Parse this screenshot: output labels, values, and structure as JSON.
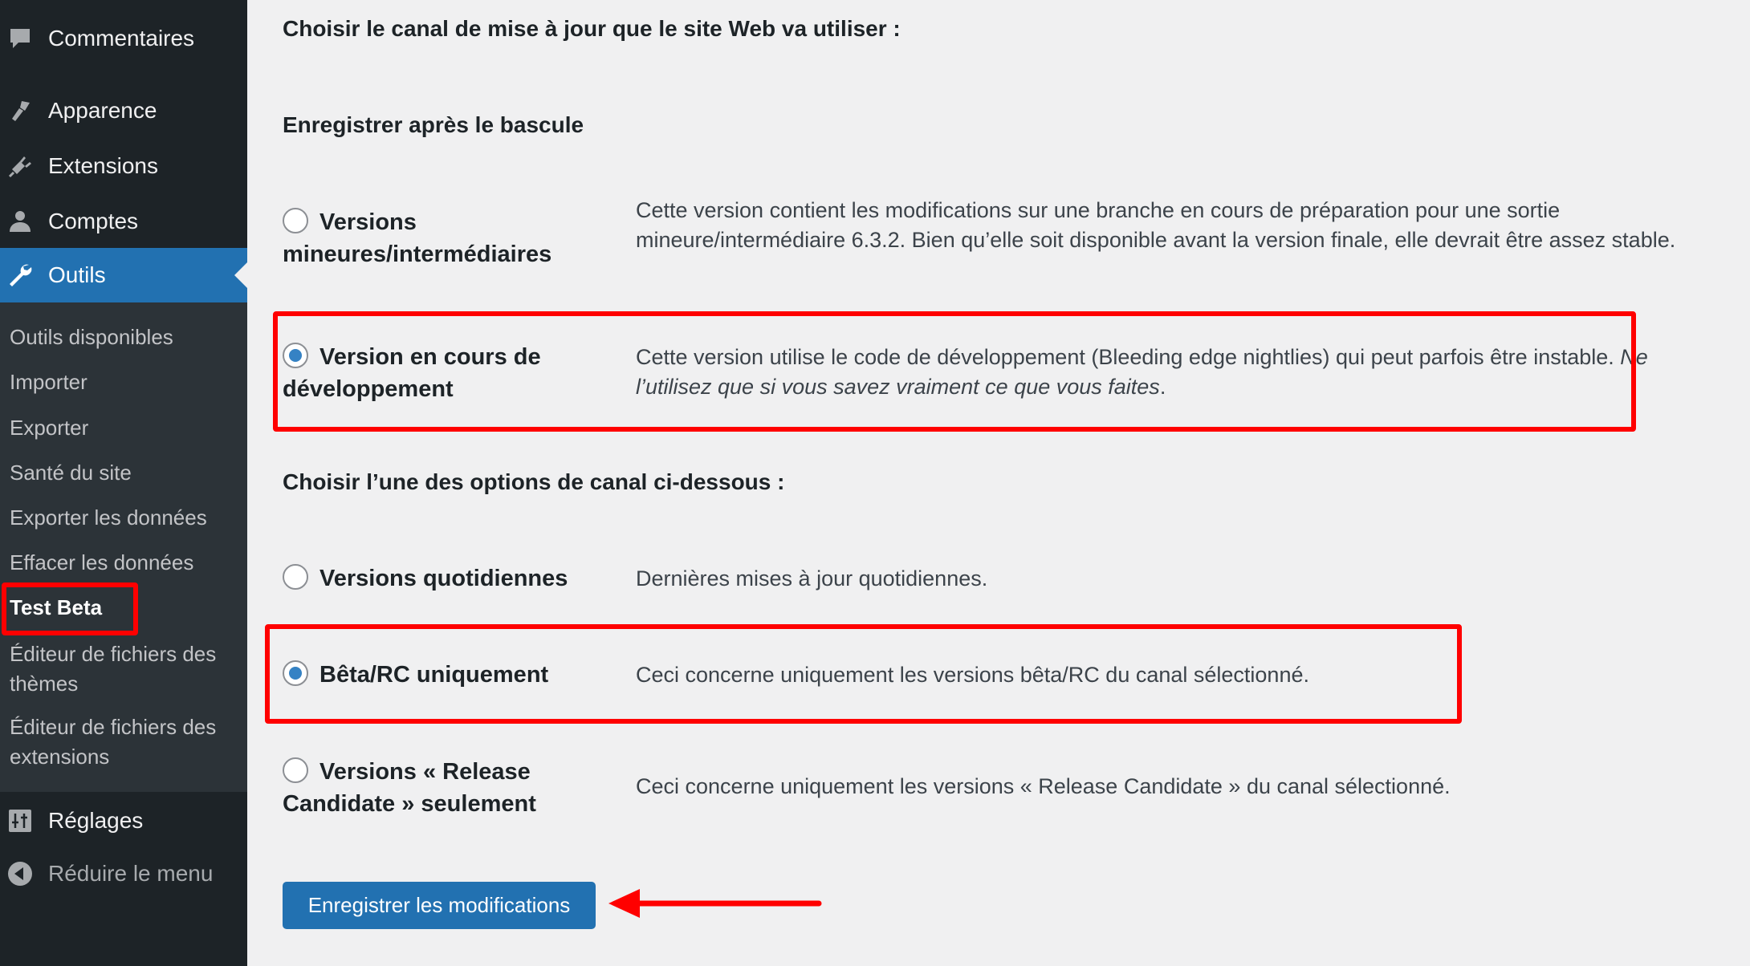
{
  "sidebar": {
    "menu": [
      {
        "label": "Commentaires",
        "icon": "comment-icon"
      },
      {
        "label": "Apparence",
        "icon": "paintbrush-icon"
      },
      {
        "label": "Extensions",
        "icon": "plugin-icon"
      },
      {
        "label": "Comptes",
        "icon": "user-icon"
      },
      {
        "label": "Outils",
        "icon": "wrench-icon",
        "active": true
      }
    ],
    "submenu": [
      "Outils disponibles",
      "Importer",
      "Exporter",
      "Santé du site",
      "Exporter les données",
      "Effacer les données",
      "Test Beta",
      "Éditeur de fichiers des thèmes",
      "Éditeur de fichiers des extensions"
    ],
    "current_submenu": "Test Beta",
    "settings_label": "Réglages",
    "collapse_label": "Réduire le menu"
  },
  "main": {
    "heading_channel": "Choisir le canal de mise à jour que le site Web va utiliser :",
    "heading_save_after": "Enregistrer après le bascule",
    "channel_options": [
      {
        "label": "Versions mineures/intermédiaires",
        "description": "Cette version contient les modifications sur une branche en cours de préparation pour une sortie mineure/intermédiaire 6.3.2. Bien qu’elle soit disponible avant la version finale, elle devrait être assez stable.",
        "checked": false
      },
      {
        "label": "Version en cours de développement",
        "description": "Cette version utilise le code de développement (Bleeding edge nightlies) qui peut parfois être instable.",
        "description_emphasis": "Ne l’utilisez que si vous savez vraiment ce que vous faites",
        "description_end": ".",
        "checked": true
      }
    ],
    "heading_stream": "Choisir l’une des options de canal ci-dessous :",
    "stream_options": [
      {
        "label": "Versions quotidiennes",
        "description": "Dernières mises à jour quotidiennes.",
        "checked": false
      },
      {
        "label": "Bêta/RC uniquement",
        "description": "Ceci concerne uniquement les versions bêta/RC du canal sélectionné.",
        "checked": true
      },
      {
        "label": "Versions « Release Candidate » seulement",
        "description": "Ceci concerne uniquement les versions « Release Candidate » du canal sélectionné.",
        "checked": false
      }
    ],
    "save_button": "Enregistrer les modifications"
  },
  "colors": {
    "accent": "#2271b1",
    "sidebar_bg": "#1d2327",
    "submenu_bg": "#2c3338",
    "annotation": "#ff0000",
    "radio_checked": "#3582c4"
  }
}
